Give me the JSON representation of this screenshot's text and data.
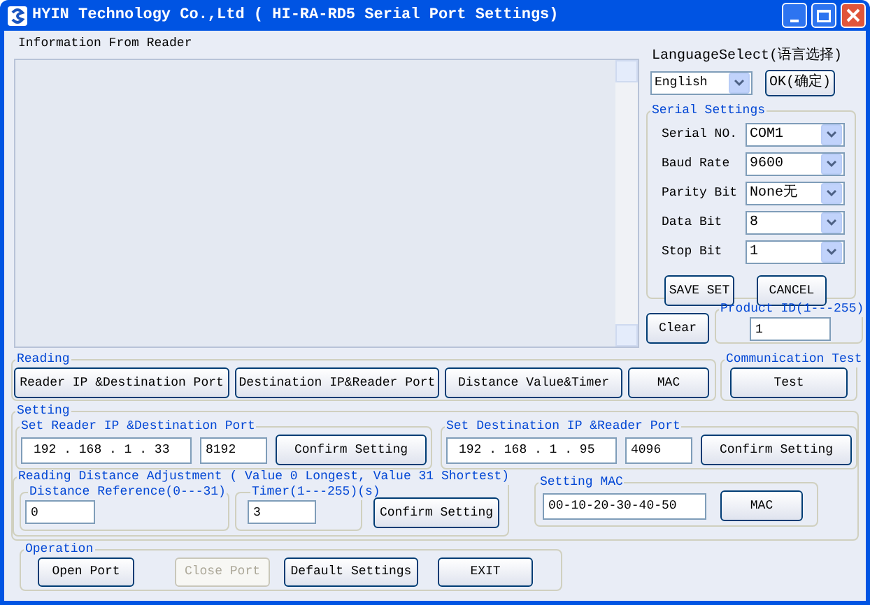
{
  "window": {
    "title": "HYIN Technology Co.,Ltd ( HI-RA-RD5 Serial Port Settings)"
  },
  "info": {
    "label": "Information From Reader"
  },
  "language": {
    "label": "LanguageSelect(语言选择)",
    "value": "English",
    "ok_button": "OK(确定)"
  },
  "serial_settings": {
    "title": "Serial Settings",
    "fields": [
      {
        "label": "Serial NO.",
        "value": "COM1"
      },
      {
        "label": "Baud Rate",
        "value": "9600"
      },
      {
        "label": "Parity Bit",
        "value": "None无"
      },
      {
        "label": "Data Bit",
        "value": "8"
      },
      {
        "label": "Stop Bit",
        "value": "1"
      }
    ],
    "buttons": [
      "SAVE SET",
      "CANCEL"
    ]
  },
  "clear_button": "Clear",
  "product_id": {
    "title": "Product ID(1---255)",
    "value": "1"
  },
  "reading": {
    "title": "Reading",
    "buttons": [
      "Reader IP &Destination Port",
      "Destination IP&Reader Port",
      "Distance Value&Timer",
      "MAC"
    ]
  },
  "communication_test": {
    "title": "Communication Test",
    "button": "Test"
  },
  "setting": {
    "title": "Setting",
    "reader_ip": {
      "title": "Set Reader IP  &Destination Port",
      "ip": "192 . 168 . 1 . 33",
      "port": "8192",
      "button": "Confirm Setting"
    },
    "destination_ip": {
      "title": "Set Destination IP &Reader Port",
      "ip": "192 . 168 . 1 . 95",
      "port": "4096",
      "button": "Confirm Setting"
    },
    "distance": {
      "title": "Reading Distance Adjustment ( Value 0 Longest,  Value 31 Shortest)",
      "reference": {
        "title": "Distance Reference(0---31)",
        "value": "0"
      },
      "timer": {
        "title": "Timer(1---255)(s)",
        "value": "3"
      },
      "button": "Confirm Setting"
    },
    "mac": {
      "title": "Setting MAC",
      "value": "00-10-20-30-40-50",
      "button": "MAC"
    }
  },
  "operation": {
    "title": "Operation",
    "buttons": [
      {
        "label": "Open Port",
        "disabled": false
      },
      {
        "label": "Close Port",
        "disabled": true
      },
      {
        "label": "Default Settings",
        "disabled": false
      },
      {
        "label": "EXIT",
        "disabled": false
      }
    ]
  }
}
